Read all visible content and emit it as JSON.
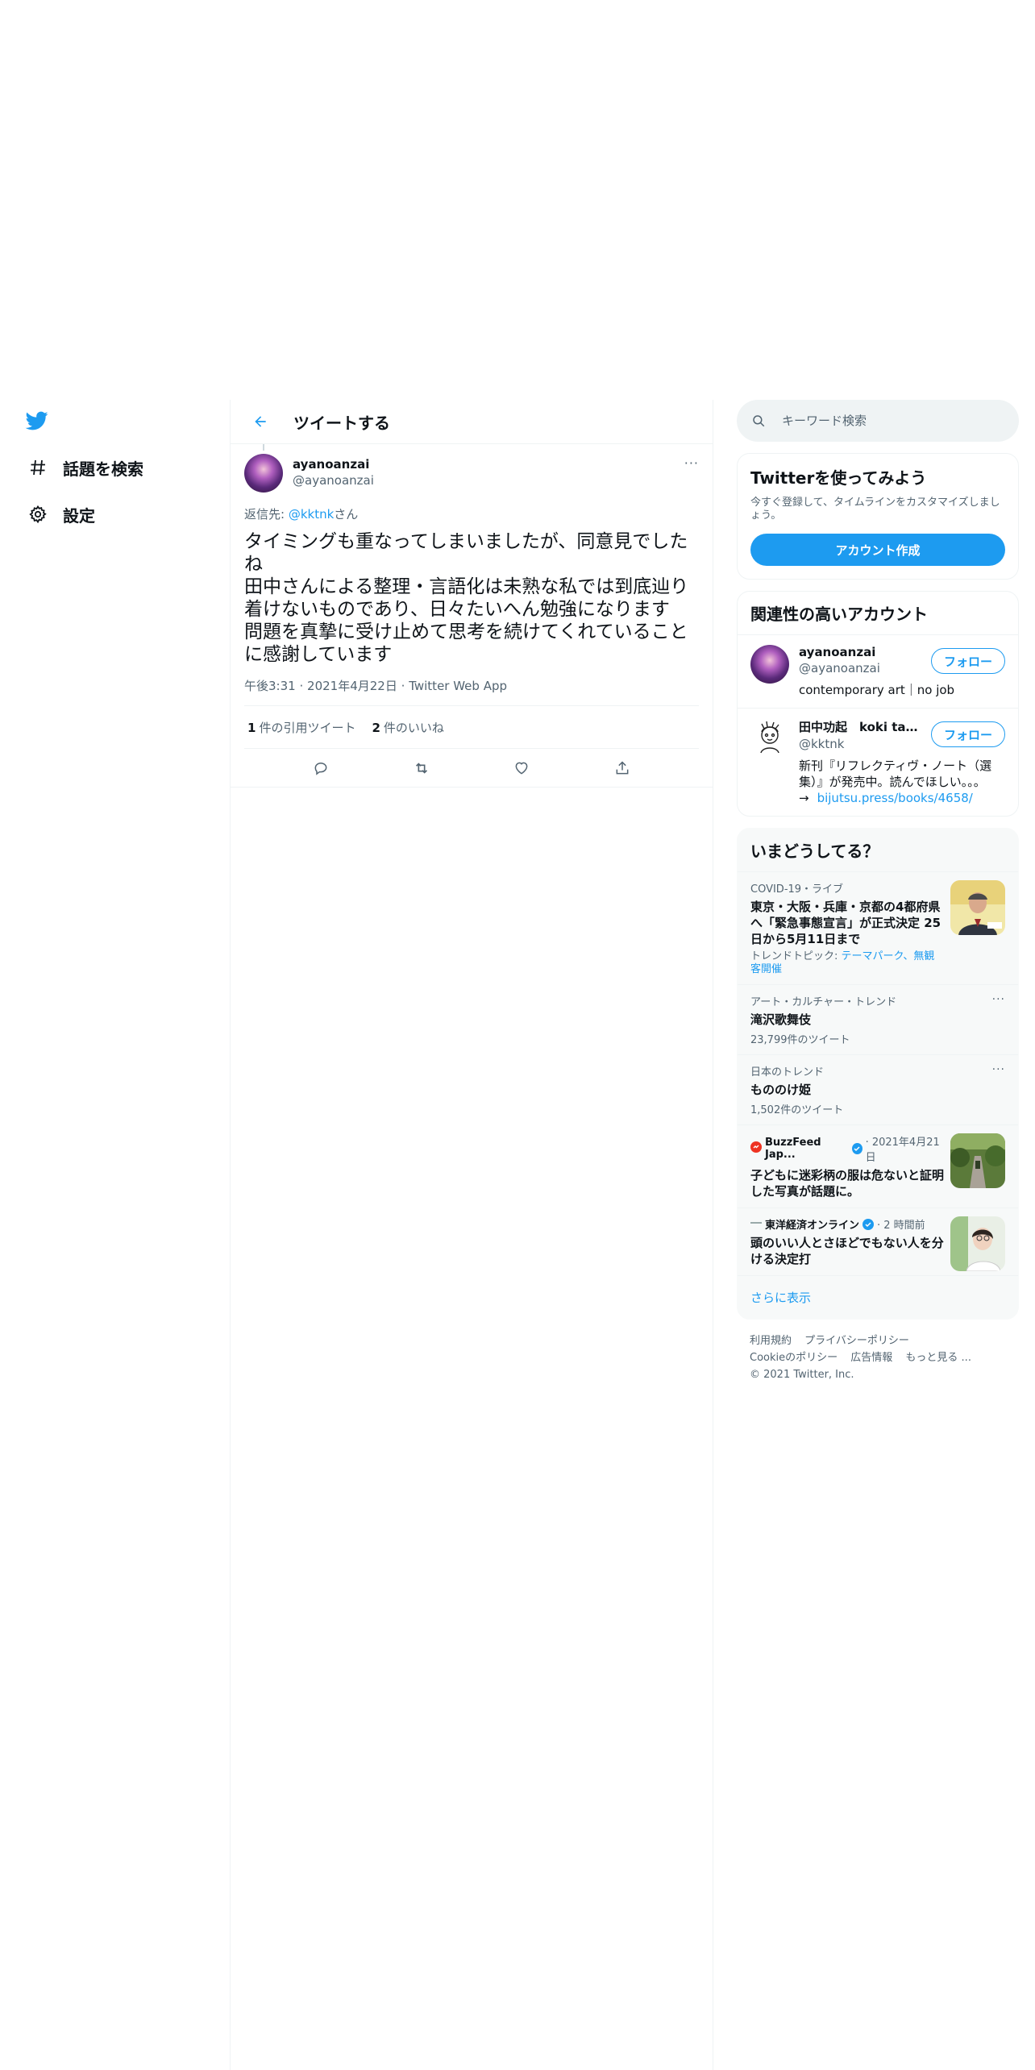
{
  "nav": {
    "items": [
      {
        "label": "話題を検索",
        "icon": "hashtag-icon"
      },
      {
        "label": "設定",
        "icon": "gear-icon"
      }
    ]
  },
  "header": {
    "title": "ツイートする"
  },
  "tweet": {
    "user_name": "ayanoanzai",
    "handle": "@ayanoanzai",
    "reply_prefix": "返信先: ",
    "reply_mention": "@kktnk",
    "reply_suffix": "さん",
    "text": "タイミングも重なってしまいましたが、同意見でしたね\n田中さんによる整理・言語化は未熟な私では到底辿り着けないものであり、日々たいへん勉強になります　問題を真摯に受け止めて思考を続けてくれていることに感謝しています",
    "time": "午後3:31",
    "date": "2021年4月22日",
    "app": "Twitter Web App",
    "separator": "·",
    "quote_count": "1",
    "quote_label": "件の引用ツイート",
    "like_count": "2",
    "like_label": "件のいいね"
  },
  "search": {
    "placeholder": "キーワード検索"
  },
  "signup": {
    "title": "Twitterを使ってみよう",
    "desc": "今すぐ登録して、タイムラインをカスタマイズしましょう。",
    "button": "アカウント作成"
  },
  "related": {
    "title": "関連性の高いアカウント",
    "accounts": [
      {
        "name": "ayanoanzai",
        "handle": "@ayanoanzai",
        "bio": "contemporary art｜no job",
        "follow": "フォロー"
      },
      {
        "name": "田中功起　koki tanaka",
        "handle": "@kktnk",
        "bio": "新刊『リフレクティヴ・ノート（選集）』が発売中。読んでほしい。。。→",
        "link": "bijutsu.press/books/4658/",
        "follow": "フォロー"
      }
    ]
  },
  "trends": {
    "title": "いまどうしてる？",
    "items": [
      {
        "context": "COVID-19・ライブ",
        "title": "東京・大阪・兵庫・京都の4都府県へ「緊急事態宣言」が正式決定 25日から5月11日まで",
        "topic_label": "トレンドトピック: ",
        "topic_links": "テーマパーク、無観客開催"
      },
      {
        "context": "アート・カルチャー・トレンド",
        "title": "滝沢歌舞伎",
        "count": "23,799件のツイート"
      },
      {
        "context": "日本のトレンド",
        "title": "もののけ姫",
        "count": "1,502件のツイート"
      },
      {
        "source": "BuzzFeed Jap...",
        "time": "· 2021年4月21日",
        "title": "子どもに迷彩柄の服は危ないと証明した写真が話題に。"
      },
      {
        "source": "東洋経済オンライン",
        "time": "· 2 時間前",
        "title": "頭のいい人とさほどでもない人を分ける決定打"
      }
    ],
    "show_more": "さらに表示"
  },
  "footer": {
    "links1": [
      "利用規約",
      "プライバシーポリシー"
    ],
    "links2": [
      "Cookieのポリシー",
      "広告情報",
      "もっと見る ..."
    ],
    "copyright": "© 2021 Twitter, Inc."
  },
  "colors": {
    "accent": "#1d9bf0",
    "text": "#0f1419",
    "secondary": "#536471",
    "border": "#eff3f4"
  }
}
